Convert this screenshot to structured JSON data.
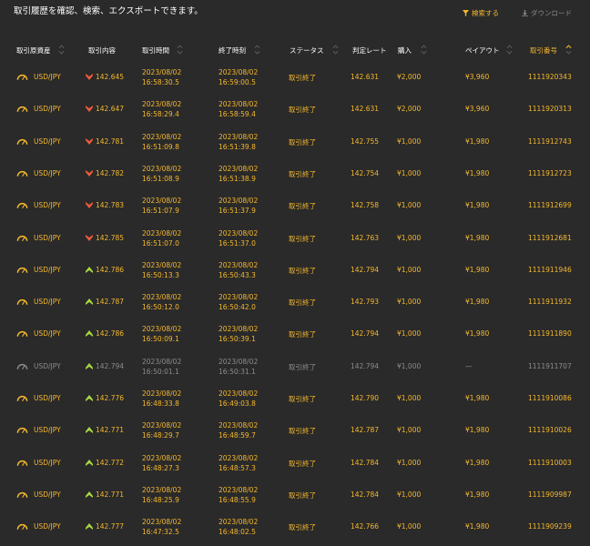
{
  "header": {
    "title": "取引履歴を確認、検索、エクスポートできます。",
    "search_label": "検索する",
    "download_label": "ダウンロード"
  },
  "table": {
    "columns": [
      "取引原資産",
      "取引内容",
      "取引時間",
      "終了時刻",
      "ステータス",
      "判定レート",
      "購入",
      "ペイアウト",
      "取引番号"
    ],
    "active_sort_column": "取引番号",
    "rows": [
      {
        "asset": "USD/JPY",
        "direction": "down",
        "entry_rate": "142.645",
        "open_date": "2023/08/02",
        "open_time": "16:58:30.5",
        "close_date": "2023/08/02",
        "close_time": "16:59:00.5",
        "status": "取引終了",
        "judge_rate": "142.631",
        "purchase": "¥2,000",
        "payout": "¥3,960",
        "trade_id": "1111920343",
        "muted": false
      },
      {
        "asset": "USD/JPY",
        "direction": "down",
        "entry_rate": "142.647",
        "open_date": "2023/08/02",
        "open_time": "16:58:29.4",
        "close_date": "2023/08/02",
        "close_time": "16:58:59.4",
        "status": "取引終了",
        "judge_rate": "142.631",
        "purchase": "¥2,000",
        "payout": "¥3,960",
        "trade_id": "1111920313",
        "muted": false
      },
      {
        "asset": "USD/JPY",
        "direction": "down",
        "entry_rate": "142.781",
        "open_date": "2023/08/02",
        "open_time": "16:51:09.8",
        "close_date": "2023/08/02",
        "close_time": "16:51:39.8",
        "status": "取引終了",
        "judge_rate": "142.755",
        "purchase": "¥1,000",
        "payout": "¥1,980",
        "trade_id": "1111912743",
        "muted": false
      },
      {
        "asset": "USD/JPY",
        "direction": "down",
        "entry_rate": "142.782",
        "open_date": "2023/08/02",
        "open_time": "16:51:08.9",
        "close_date": "2023/08/02",
        "close_time": "16:51:38.9",
        "status": "取引終了",
        "judge_rate": "142.754",
        "purchase": "¥1,000",
        "payout": "¥1,980",
        "trade_id": "1111912723",
        "muted": false
      },
      {
        "asset": "USD/JPY",
        "direction": "down",
        "entry_rate": "142.783",
        "open_date": "2023/08/02",
        "open_time": "16:51:07.9",
        "close_date": "2023/08/02",
        "close_time": "16:51:37.9",
        "status": "取引終了",
        "judge_rate": "142.758",
        "purchase": "¥1,000",
        "payout": "¥1,980",
        "trade_id": "1111912699",
        "muted": false
      },
      {
        "asset": "USD/JPY",
        "direction": "down",
        "entry_rate": "142.785",
        "open_date": "2023/08/02",
        "open_time": "16:51:07.0",
        "close_date": "2023/08/02",
        "close_time": "16:51:37.0",
        "status": "取引終了",
        "judge_rate": "142.763",
        "purchase": "¥1,000",
        "payout": "¥1,980",
        "trade_id": "1111912681",
        "muted": false
      },
      {
        "asset": "USD/JPY",
        "direction": "up",
        "entry_rate": "142.786",
        "open_date": "2023/08/02",
        "open_time": "16:50:13.3",
        "close_date": "2023/08/02",
        "close_time": "16:50:43.3",
        "status": "取引終了",
        "judge_rate": "142.794",
        "purchase": "¥1,000",
        "payout": "¥1,980",
        "trade_id": "1111911946",
        "muted": false
      },
      {
        "asset": "USD/JPY",
        "direction": "up",
        "entry_rate": "142.787",
        "open_date": "2023/08/02",
        "open_time": "16:50:12.0",
        "close_date": "2023/08/02",
        "close_time": "16:50:42.0",
        "status": "取引終了",
        "judge_rate": "142.793",
        "purchase": "¥1,000",
        "payout": "¥1,980",
        "trade_id": "1111911932",
        "muted": false
      },
      {
        "asset": "USD/JPY",
        "direction": "up",
        "entry_rate": "142.786",
        "open_date": "2023/08/02",
        "open_time": "16:50:09.1",
        "close_date": "2023/08/02",
        "close_time": "16:50:39.1",
        "status": "取引終了",
        "judge_rate": "142.794",
        "purchase": "¥1,000",
        "payout": "¥1,980",
        "trade_id": "1111911890",
        "muted": false
      },
      {
        "asset": "USD/JPY",
        "direction": "up",
        "entry_rate": "142.794",
        "open_date": "2023/08/02",
        "open_time": "16:50:01.1",
        "close_date": "2023/08/02",
        "close_time": "16:50:31.1",
        "status": "取引終了",
        "judge_rate": "142.794",
        "purchase": "¥1,000",
        "payout": "—",
        "trade_id": "1111911707",
        "muted": true
      },
      {
        "asset": "USD/JPY",
        "direction": "up",
        "entry_rate": "142.776",
        "open_date": "2023/08/02",
        "open_time": "16:48:33.8",
        "close_date": "2023/08/02",
        "close_time": "16:49:03.8",
        "status": "取引終了",
        "judge_rate": "142.790",
        "purchase": "¥1,000",
        "payout": "¥1,980",
        "trade_id": "1111910086",
        "muted": false
      },
      {
        "asset": "USD/JPY",
        "direction": "up",
        "entry_rate": "142.771",
        "open_date": "2023/08/02",
        "open_time": "16:48:29.7",
        "close_date": "2023/08/02",
        "close_time": "16:48:59.7",
        "status": "取引終了",
        "judge_rate": "142.787",
        "purchase": "¥1,000",
        "payout": "¥1,980",
        "trade_id": "1111910026",
        "muted": false
      },
      {
        "asset": "USD/JPY",
        "direction": "up",
        "entry_rate": "142.772",
        "open_date": "2023/08/02",
        "open_time": "16:48:27.3",
        "close_date": "2023/08/02",
        "close_time": "16:48:57.3",
        "status": "取引終了",
        "judge_rate": "142.784",
        "purchase": "¥1,000",
        "payout": "¥1,980",
        "trade_id": "1111910003",
        "muted": false
      },
      {
        "asset": "USD/JPY",
        "direction": "up",
        "entry_rate": "142.771",
        "open_date": "2023/08/02",
        "open_time": "16:48:25.9",
        "close_date": "2023/08/02",
        "close_time": "16:48:55.9",
        "status": "取引終了",
        "judge_rate": "142.784",
        "purchase": "¥1,000",
        "payout": "¥1,980",
        "trade_id": "1111909987",
        "muted": false
      },
      {
        "asset": "USD/JPY",
        "direction": "up",
        "entry_rate": "142.777",
        "open_date": "2023/08/02",
        "open_time": "16:47:32.5",
        "close_date": "2023/08/02",
        "close_time": "16:48:02.5",
        "status": "取引終了",
        "judge_rate": "142.766",
        "purchase": "¥1,000",
        "payout": "¥1,980",
        "trade_id": "1111909239",
        "muted": false
      }
    ]
  },
  "colors": {
    "background": "#2a2a2a",
    "accent": "#f5b82e",
    "header_text": "#ffffff",
    "muted_text": "#8c8c8c",
    "down_icon": "#f05a3c",
    "up_icon": "#a8d840"
  },
  "icons": {
    "search": "filter-icon",
    "download": "download-icon",
    "asset": "gauge-icon",
    "direction_down": "arrow-down-icon",
    "direction_up": "arrow-up-icon",
    "sort": "sort-icon"
  }
}
